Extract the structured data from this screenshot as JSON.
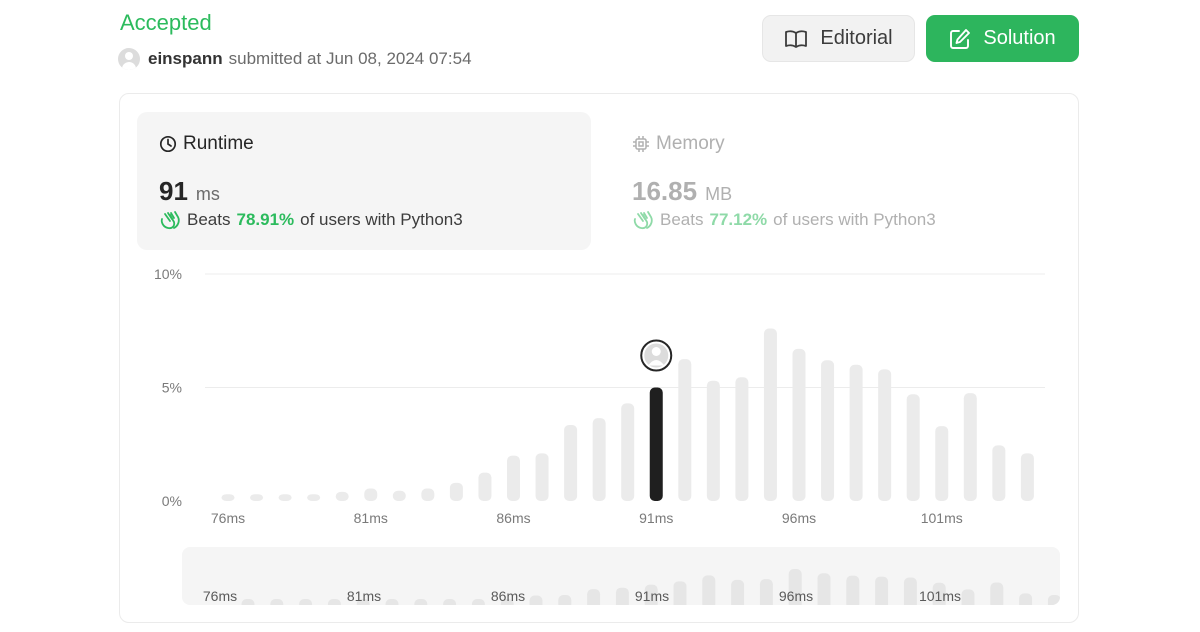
{
  "header": {
    "status": "Accepted",
    "username": "einspann",
    "submitted_text": "submitted at Jun 08, 2024 07:54"
  },
  "actions": {
    "editorial_label": "Editorial",
    "solution_label": "Solution",
    "solution_color": "#2db55d"
  },
  "runtime": {
    "title": "Runtime",
    "value": "91",
    "unit": "ms",
    "beats_prefix": "Beats",
    "beats_pct": "78.91%",
    "beats_suffix": "of users with Python3",
    "icon": "clock-icon"
  },
  "memory": {
    "title": "Memory",
    "value": "16.85",
    "unit": "MB",
    "beats_prefix": "Beats",
    "beats_pct": "77.12%",
    "beats_suffix": "of users with Python3",
    "icon": "chip-icon"
  },
  "chart_data": {
    "type": "bar",
    "y_tick_labels": [
      "10%",
      "5%",
      "0%"
    ],
    "ylim": [
      0,
      10
    ],
    "grid": true,
    "x_tick_labels": [
      "76ms",
      "81ms",
      "86ms",
      "91ms",
      "96ms",
      "101ms"
    ],
    "categories": [
      "76ms",
      "77ms",
      "78ms",
      "79ms",
      "80ms",
      "81ms",
      "82ms",
      "83ms",
      "84ms",
      "85ms",
      "86ms",
      "87ms",
      "88ms",
      "89ms",
      "90ms",
      "91ms",
      "92ms",
      "93ms",
      "94ms",
      "95ms",
      "96ms",
      "97ms",
      "98ms",
      "99ms",
      "100ms",
      "101ms",
      "102ms",
      "103ms",
      "104ms",
      "105ms"
    ],
    "values": [
      0.3,
      0.3,
      0.3,
      0.3,
      0.4,
      0.55,
      0.45,
      0.55,
      0.8,
      1.25,
      2.0,
      2.1,
      3.35,
      3.65,
      4.3,
      5.0,
      6.25,
      5.3,
      5.45,
      7.6,
      6.7,
      6.2,
      6.0,
      5.8,
      4.7,
      3.3,
      4.75,
      2.45,
      2.1,
      0.0
    ],
    "highlight_category": "91ms",
    "highlight_color": "#1f1f1f",
    "bar_color": "#ebebeb"
  }
}
